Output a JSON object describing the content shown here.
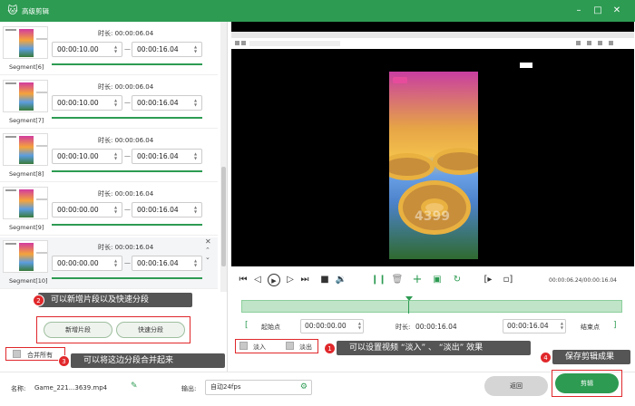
{
  "window": {
    "title": "高级剪辑",
    "brand_color": "#2d9b52",
    "accent_red": "#e0282b"
  },
  "segments": [
    {
      "name": "Segment[6]",
      "duration_label": "时长: 00:00:06.04",
      "start": "00:00:10.00",
      "end": "00:00:16.04"
    },
    {
      "name": "Segment[7]",
      "duration_label": "时长: 00:00:06.04",
      "start": "00:00:10.00",
      "end": "00:00:16.04"
    },
    {
      "name": "Segment[8]",
      "duration_label": "时长: 00:00:06.04",
      "start": "00:00:10.00",
      "end": "00:00:16.04"
    },
    {
      "name": "Segment[9]",
      "duration_label": "时长: 00:00:16.04",
      "start": "00:00:00.00",
      "end": "00:00:16.04"
    },
    {
      "name": "Segment[10]",
      "duration_label": "时长: 00:00:16.04",
      "start": "00:00:00.00",
      "end": "00:00:16.04"
    }
  ],
  "left_actions": {
    "add_segment": "新增片段",
    "quick_split": "快速分段",
    "merge_all": "合并所有"
  },
  "tips": {
    "t1": "可以设置视频 “淡入” 、 “淡出” 效果",
    "t2": "可以新增片段以及快速分段",
    "t3": "可以将这边分段合并起来",
    "t4": "保存剪辑成果",
    "b1": "1",
    "b2": "2",
    "b3": "3",
    "b4": "4"
  },
  "player": {
    "time_display": "00:00:06.24/00:00:16.04",
    "watermark": "4399"
  },
  "range": {
    "start_label": "起始点",
    "start_value": "00:00:00.00",
    "duration_label": "时长:",
    "duration_value": "00:00:16.04",
    "end_value": "00:00:16.04",
    "end_label": "结束点"
  },
  "fade": {
    "fade_in": "淡入",
    "fade_out": "淡出"
  },
  "footer": {
    "name_label": "名称:",
    "name_value": "Game_221...3639.mp4",
    "output_label": "输出:",
    "output_value": "自动24fps",
    "back": "返回",
    "clip": "剪辑"
  }
}
